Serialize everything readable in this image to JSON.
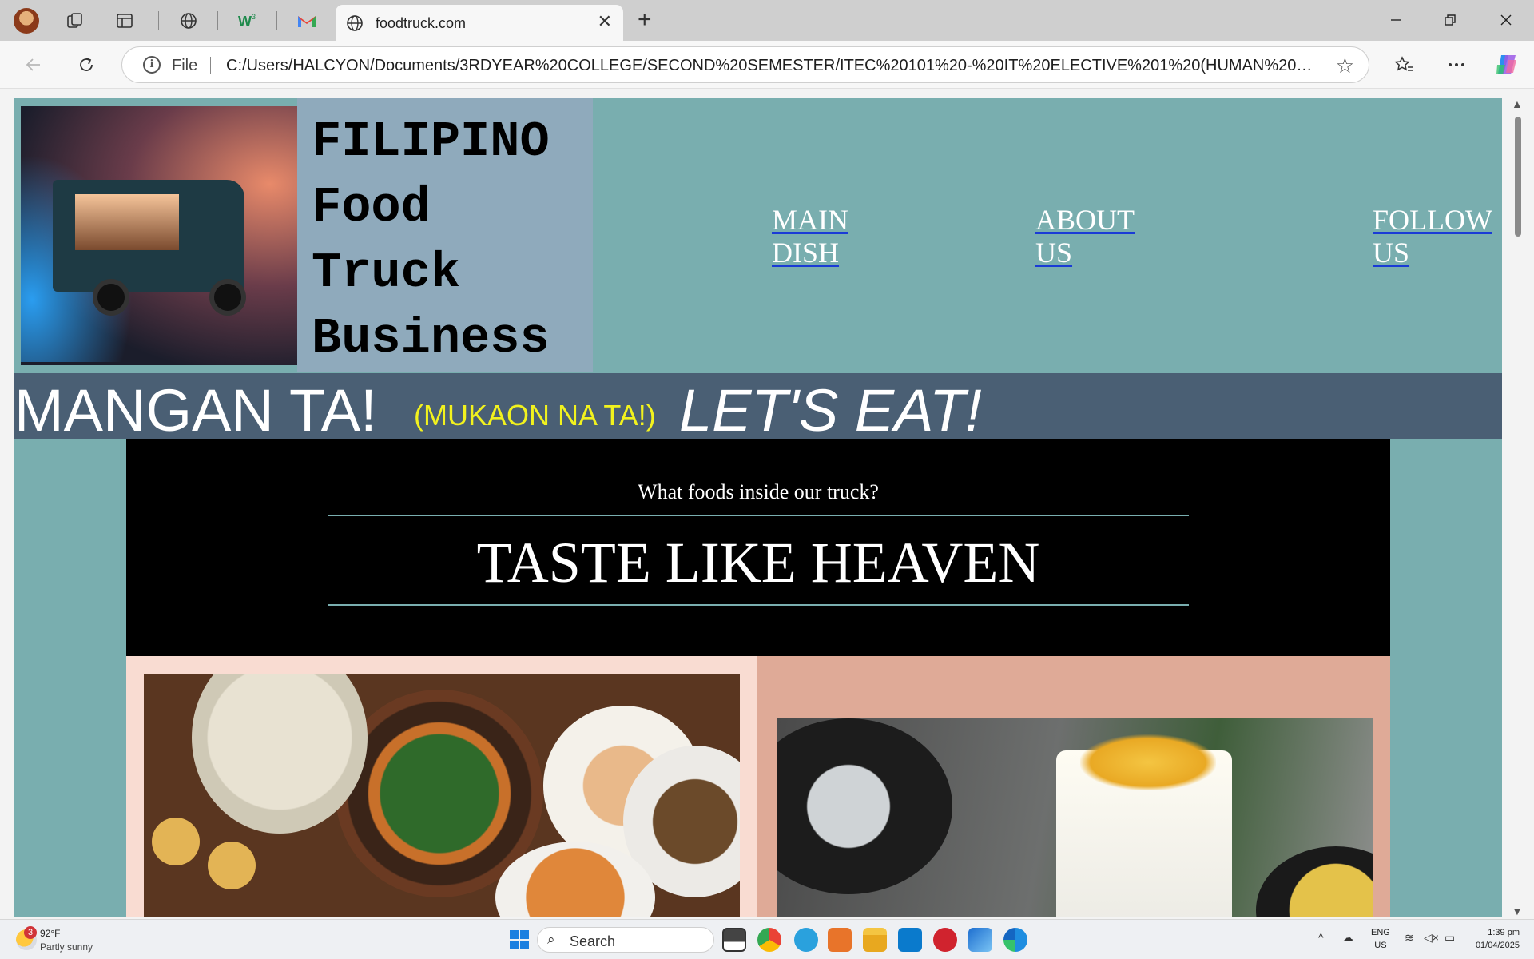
{
  "browser": {
    "tab_title": "foodtruck.com",
    "tab_close": "✕",
    "new_tab": "+",
    "url_scheme_label": "File",
    "url": "C:/Users/HALCYON/Documents/3RDYEAR%20COLLEGE/SECOND%20SEMESTER/ITEC%20101%20-%20IT%20ELECTIVE%201%20(HUMAN%20CO..."
  },
  "page": {
    "hero_title_lines": [
      "FILIPINO",
      "Food",
      "Truck",
      "Business"
    ],
    "nav": [
      {
        "line1": "MAIN",
        "line2": "DISH"
      },
      {
        "line1": "ABOUT",
        "line2": "US"
      },
      {
        "line1": "FOLLOW",
        "line2": "US"
      }
    ],
    "banner": {
      "part1": "MANGAN TA!",
      "part2": "(MUKAON NA TA!)",
      "part3": "LET'S EAT!"
    },
    "section": {
      "question": "What foods inside our truck?",
      "heading": "TASTE LIKE HEAVEN"
    }
  },
  "taskbar": {
    "weather_badge": "3",
    "weather_temp": "92°F",
    "weather_desc": "Partly sunny",
    "search_label": "Search",
    "lang_line1": "ENG",
    "lang_line2": "US",
    "time": "1:39 pm",
    "date": "01/04/2025"
  },
  "colors": {
    "page_bg": "#79aeaf",
    "title_box": "#8faabc",
    "banner_bg": "#4a5f74",
    "banner_accent": "#f2f21e",
    "panel_left": "#f9dcd2",
    "panel_right": "#dfaa97"
  }
}
